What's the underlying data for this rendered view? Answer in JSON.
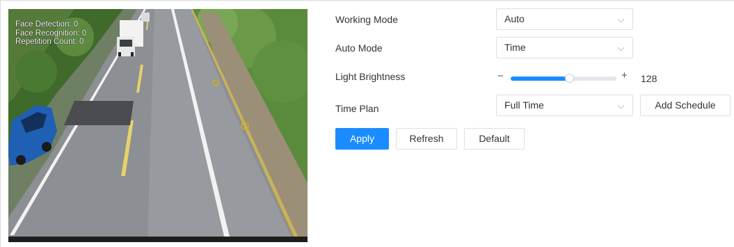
{
  "preview": {
    "osd": {
      "face_detection": "Face Detection: 0",
      "face_recognition": "Face Recognition: 0",
      "repetition_count": "Repetition Count: 0"
    }
  },
  "form": {
    "working_mode": {
      "label": "Working Mode",
      "value": "Auto"
    },
    "auto_mode": {
      "label": "Auto Mode",
      "value": "Time"
    },
    "light_brightness": {
      "label": "Light Brightness",
      "minus": "−",
      "plus": "+",
      "value": "128",
      "min": 0,
      "max": 255,
      "level": 128
    },
    "time_plan": {
      "label": "Time Plan",
      "value": "Full Time",
      "add_schedule_label": "Add Schedule"
    }
  },
  "actions": {
    "apply_label": "Apply",
    "refresh_label": "Refresh",
    "default_label": "Default"
  },
  "colors": {
    "primary": "#1a8cff",
    "border": "#dcdfe6",
    "text": "#333333"
  },
  "icons": {
    "dropdown": "chevron-down-icon"
  }
}
